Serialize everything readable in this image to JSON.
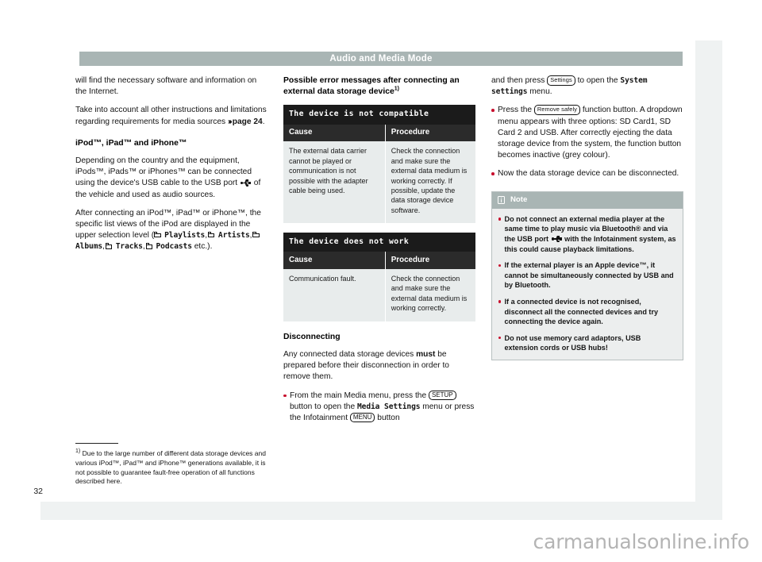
{
  "header": {
    "title": "Audio and Media Mode"
  },
  "page_number": "32",
  "watermark": "carmanualsonline.info",
  "column_left": {
    "para_1": "will find the necessary software and information on the Internet.",
    "para_2_a": "Take into account all other instructions and limitations regarding requirements for media sources ",
    "para_2_arrow": "›››",
    "para_2_ref": "page 24",
    "para_2_end": ".",
    "heading_ipod": "iPod™, iPad™ and iPhone™",
    "para_3_a": "Depending on the country and the equipment, iPods™, iPads™ or iPhones™ can be connected using the device's USB cable to the USB port ",
    "para_3_b": " of the vehicle and used as audio sources.",
    "para_4_a": "After connecting an iPod™, iPad™ or iPhone™, the specific list views of the iPod are displayed in the upper selection level (",
    "list_items": [
      "Playlists",
      "Artists",
      "Albums",
      "Tracks",
      "Podcasts"
    ],
    "para_4_end": " etc.)."
  },
  "column_mid": {
    "heading_errors_a": "Possible error messages after connecting an external data storage device",
    "heading_errors_sup": "1)",
    "table_1": {
      "caption": "The device is not compatible",
      "headers": [
        "Cause",
        "Procedure"
      ],
      "rows": [
        [
          "The external data carrier cannot be played or communication is not possible with the adapter cable being used.",
          "Check the connection and make sure the external data medium is working correctly. If possible, update the data storage device software."
        ]
      ]
    },
    "table_2": {
      "caption": "The device does not work",
      "headers": [
        "Cause",
        "Procedure"
      ],
      "rows": [
        [
          "Communication fault.",
          "Check the connection and make sure the external data medium is working correctly."
        ]
      ]
    },
    "heading_disconnecting": "Disconnecting",
    "para_disconnect_a": "Any connected data storage devices ",
    "para_disconnect_must": "must",
    "para_disconnect_b": " be prepared before their disconnection in order to remove them.",
    "bullet_1_a": "From the main Media menu, press the ",
    "bullet_1_key_setup": "SETUP",
    "bullet_1_b": " button to open the ",
    "bullet_1_mono": "Media Settings",
    "bullet_1_c": " menu or press the Infotainment ",
    "bullet_1_key_menu": "MENU",
    "bullet_1_d": " button"
  },
  "column_right": {
    "para_continue_a": "and then press ",
    "para_continue_key": "Settings",
    "para_continue_b": " to open the ",
    "para_continue_mono": "System settings",
    "para_continue_c": " menu.",
    "bullet_1_a": "Press the ",
    "bullet_1_key": "Remove safely",
    "bullet_1_b": " function button. A dropdown menu appears with three options: SD Card1, SD Card 2 and USB. After correctly ejecting the data storage device from the system, the function button becomes inactive (grey colour).",
    "bullet_2": "Now the data storage device can be disconnected.",
    "note": {
      "title": "Note",
      "items_pre_usb": "Do not connect an external media player at the same time to play music via Bluetooth® and via the USB port ",
      "items_post_usb": " with the Infotainment system, as this could cause playback limitations.",
      "item_2": "If the external player is an Apple device™, it cannot be simultaneously connected by USB and by Bluetooth.",
      "item_3": "If a connected device is not recognised, disconnect all the connected devices and try connecting the device again.",
      "item_4": "Do not use memory card adaptors, USB extension cords or USB hubs!"
    }
  },
  "footnote": {
    "marker": "1)",
    "text": " Due to the large number of different data storage devices and various iPod™, iPad™ and iPhone™ generations available, it is not possible to guarantee fault-free operation of all functions described here."
  },
  "colors": {
    "header_bar": "#a9b5b4",
    "table_caption_bg": "#1b1b1b",
    "table_header_bg": "#2b2b2b",
    "table_cell_bg": "#e8ecec",
    "bullet_red": "#c8102e",
    "note_bg": "#eceeee",
    "page_bg": "#ffffff",
    "outer_bg": "#eff2f2"
  }
}
